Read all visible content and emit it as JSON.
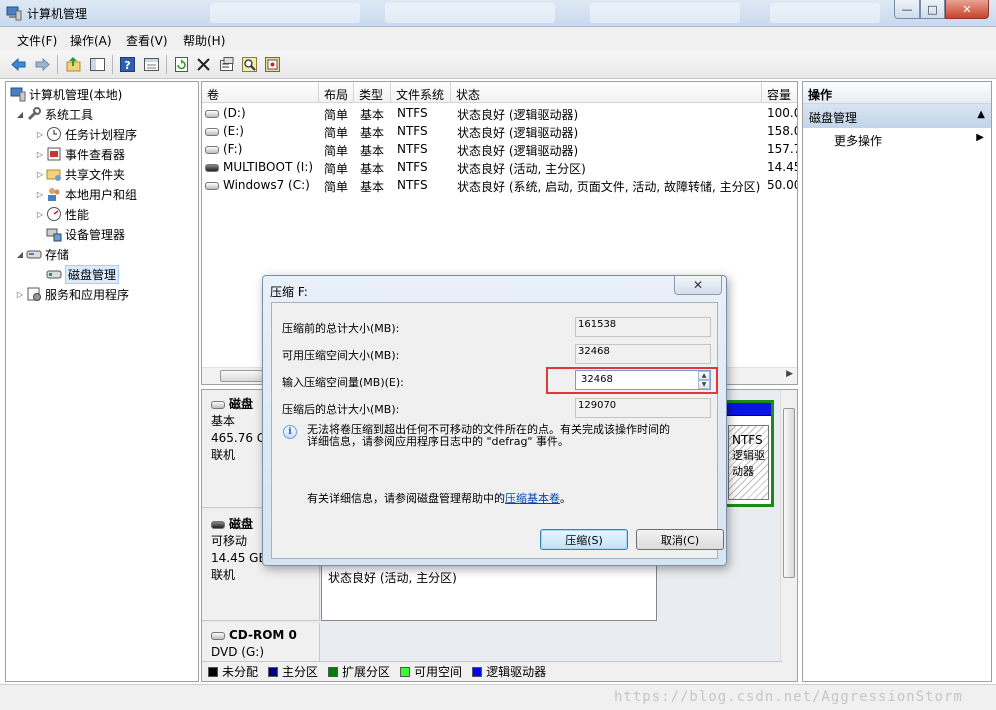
{
  "window": {
    "title": "计算机管理",
    "controls": {
      "minimize": "—",
      "maximize": "□",
      "close": "✕"
    }
  },
  "menu": [
    "文件(F)",
    "操作(A)",
    "查看(V)",
    "帮助(H)"
  ],
  "toolbar_icons": [
    "back-icon",
    "forward-icon",
    "up-icon",
    "show-tree-icon",
    "help-icon",
    "properties-view-icon",
    "refresh-icon",
    "delete-icon",
    "properties-icon",
    "search-icon",
    "wizard-icon"
  ],
  "tree": {
    "root": "计算机管理(本地)",
    "system_tools": "系统工具",
    "task_scheduler": "任务计划程序",
    "event_viewer": "事件查看器",
    "shared_folders": "共享文件夹",
    "local_users": "本地用户和组",
    "performance": "性能",
    "device_manager": "设备管理器",
    "storage": "存储",
    "disk_management": "磁盘管理",
    "services_apps": "服务和应用程序"
  },
  "volume_list": {
    "columns": [
      "卷",
      "布局",
      "类型",
      "文件系统",
      "状态",
      "容量"
    ],
    "rows": [
      {
        "volume": "(D:)",
        "layout": "简单",
        "type": "基本",
        "fs": "NTFS",
        "status": "状态良好 (逻辑驱动器)",
        "capacity": "100.0"
      },
      {
        "volume": "(E:)",
        "layout": "简单",
        "type": "基本",
        "fs": "NTFS",
        "status": "状态良好 (逻辑驱动器)",
        "capacity": "158.0"
      },
      {
        "volume": "(F:)",
        "layout": "简单",
        "type": "基本",
        "fs": "NTFS",
        "status": "状态良好 (逻辑驱动器)",
        "capacity": "157.7"
      },
      {
        "volume": "MULTIBOOT (I:)",
        "layout": "简单",
        "type": "基本",
        "fs": "NTFS",
        "status": "状态良好 (活动, 主分区)",
        "capacity": "14.45"
      },
      {
        "volume": "Windows7 (C:)",
        "layout": "简单",
        "type": "基本",
        "fs": "NTFS",
        "status": "状态良好 (系统, 启动, 页面文件, 活动, 故障转储, 主分区)",
        "capacity": "50.00"
      }
    ]
  },
  "disk_map": {
    "disk0": {
      "name": "磁盘",
      "type": "基本",
      "size": "465.76 G",
      "status": "联机",
      "partition_fs": "NTFS",
      "partition_status": "逻辑驱动器"
    },
    "disk1": {
      "name": "磁盘",
      "type": "可移动",
      "size": "14.45 GB",
      "status": "联机",
      "partition_status": "状态良好 (活动, 主分区)"
    },
    "cdrom": {
      "name": "CD-ROM 0",
      "drive": "DVD (G:)"
    },
    "legend": [
      {
        "label": "未分配",
        "color": "#000000"
      },
      {
        "label": "主分区",
        "color": "#000080"
      },
      {
        "label": "扩展分区",
        "color": "#008000"
      },
      {
        "label": "可用空间",
        "color": "#33ff33"
      },
      {
        "label": "逻辑驱动器",
        "color": "#0000ff"
      }
    ]
  },
  "actions_pane": {
    "header": "操作",
    "section": "磁盘管理",
    "more": "更多操作"
  },
  "dialog": {
    "title": "压缩 F:",
    "total_before_label": "压缩前的总计大小(MB):",
    "total_before_value": "161538",
    "available_label": "可用压缩空间大小(MB):",
    "available_value": "32468",
    "input_label": "输入压缩空间量(MB)(E):",
    "input_value": "32468",
    "total_after_label": "压缩后的总计大小(MB):",
    "total_after_value": "129070",
    "info_line1": "无法将卷压缩到超出任何不可移动的文件所在的点。有关完成该操作时间的",
    "info_line2": "详细信息，请参阅应用程序日志中的 \"defrag\" 事件。",
    "help_prefix": "有关详细信息，请参阅磁盘管理帮助中的",
    "help_link": "压缩基本卷",
    "help_suffix": "。",
    "shrink_button": "压缩(S)",
    "cancel_button": "取消(C)",
    "close": "✕"
  },
  "statusbar": {
    "watermark": "https://blog.csdn.net/AggressionStorm"
  }
}
